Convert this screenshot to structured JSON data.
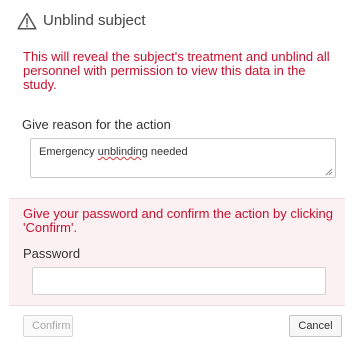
{
  "dialog": {
    "title": "Unblind subject",
    "header_icon": "warning-triangle-icon",
    "warning_message": "This will reveal the subject's treatment and unblind all personnel with permission to view this data in the study.",
    "reason": {
      "label": "Give reason for the action",
      "value_before": "Emergency ",
      "value_misspelled": "unblinding",
      "value_after": " needed"
    },
    "confirm_message": "Give your password and confirm the action by clicking 'Confirm'.",
    "password": {
      "label": "Password",
      "value": ""
    },
    "buttons": {
      "confirm_label": "Confirm",
      "cancel_label": "Cancel"
    }
  },
  "colors": {
    "warning_text": "#c8102e",
    "confirm_panel_bg": "#fbf1f3"
  }
}
